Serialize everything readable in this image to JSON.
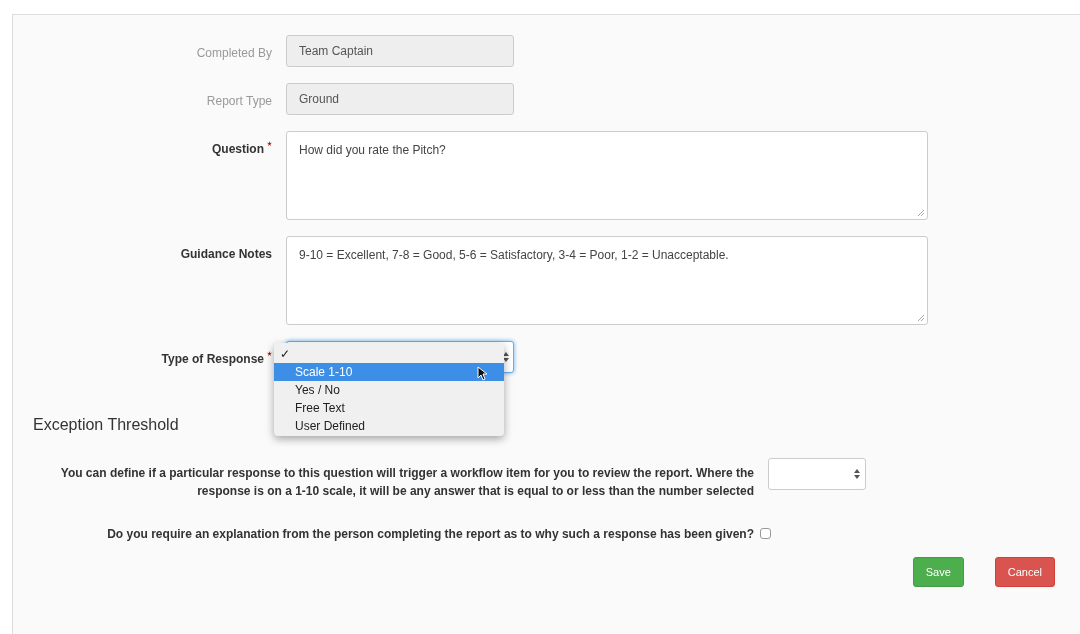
{
  "fields": [
    {
      "kind": "readonly",
      "label": "Completed By",
      "required": false,
      "value": "Team Captain"
    },
    {
      "kind": "readonly",
      "label": "Report Type",
      "required": false,
      "value": "Ground"
    },
    {
      "kind": "textarea",
      "label": "Question",
      "required": true,
      "value": "How did you rate the Pitch?"
    },
    {
      "kind": "textarea",
      "label": "Guidance Notes",
      "required": false,
      "value": "9-10 = Excellent,  7-8 = Good,  5-6 = Satisfactory,  3-4 = Poor, 1-2 = Unacceptable."
    }
  ],
  "type_of_response": {
    "label": "Type of Response",
    "required": true,
    "menu": {
      "check_mark": "✓",
      "options": [
        {
          "label": "Scale 1-10",
          "selected": true
        },
        {
          "label": "Yes / No",
          "selected": false
        },
        {
          "label": "Free Text",
          "selected": false
        },
        {
          "label": "User Defined",
          "selected": false
        }
      ]
    }
  },
  "exception_threshold": {
    "heading": "Exception Threshold",
    "threshold_text": "You can define if a particular response to this question will trigger a workflow item for you to review the report. Where the response is on a 1-10 scale, it will be any answer that is equal to or less than the number selected",
    "explanation_text": "Do you require an explanation from the person completing the report as to why such a response has been given?",
    "explanation_checked": false
  },
  "buttons": [
    {
      "kind": "save",
      "label": "Save"
    },
    {
      "kind": "cancel",
      "label": "Cancel"
    }
  ]
}
